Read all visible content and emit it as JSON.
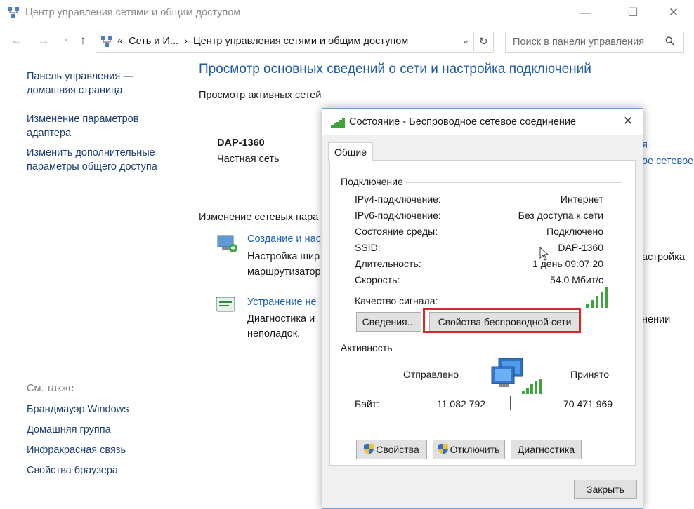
{
  "window": {
    "title": "Центр управления сетями и общим доступом",
    "minimize_symbol": "—",
    "maximize_symbol": "☐",
    "close_symbol": "✕"
  },
  "address": {
    "back_symbol": "←",
    "forward_symbol": "→",
    "dropdown_symbol": "⌄",
    "up_symbol": "↑",
    "chevrons": "«",
    "crumb_1": "Сеть и И...",
    "separator": "›",
    "crumb_2": "Центр управления сетями и общим доступом",
    "expand_symbol": "⌄",
    "refresh_symbol": "↻"
  },
  "search": {
    "placeholder": "Поиск в панели управления",
    "icon_symbol": "⚲"
  },
  "sidebar": {
    "home_line1": "Панель управления —",
    "home_line2": "домашняя страница",
    "adapter_line1": "Изменение параметров",
    "adapter_line2": "адаптера",
    "sharing_line1": "Изменить дополнительные",
    "sharing_line2": "параметры общего доступа",
    "see_also": "См. также",
    "links": [
      "Брандмауэр Windows",
      "Домашняя группа",
      "Инфракрасная связь",
      "Свойства браузера"
    ]
  },
  "main": {
    "heading": "Просмотр основных сведений о сети и настройка подключений",
    "active_networks": "Просмотр активных сетей",
    "network_name": "DAP-1360",
    "network_type": "Частная сеть",
    "right_link_1": "я",
    "right_link_2": "ое сетевое",
    "change_settings": "Изменение сетевых пара",
    "create_link": "Создание и нас",
    "create_desc_1": "Настройка шир",
    "create_desc_2": "маршрутизатор",
    "create_right": "астройка",
    "troubleshoot_link": "Устранение не",
    "troubleshoot_desc_1": "Диагностика и",
    "troubleshoot_desc_2": "неполадок.",
    "troubleshoot_right": "нении"
  },
  "dialog": {
    "title": "Состояние - Беспроводное сетевое соединение",
    "close_symbol": "✕",
    "tab": "Общие",
    "connection_group": "Подключение",
    "rows": [
      {
        "label": "IPv4-подключение:",
        "value": "Интернет"
      },
      {
        "label": "IPv6-подключение:",
        "value": "Без доступа к сети"
      },
      {
        "label": "Состояние среды:",
        "value": "Подключено"
      },
      {
        "label": "SSID:",
        "value": "DAP-1360"
      },
      {
        "label": "Длительность:",
        "value": "1 день 09:07:20"
      },
      {
        "label": "Скорость:",
        "value": "54.0 Мбит/с"
      }
    ],
    "signal_label": "Качество сигнала:",
    "signal_bars": 5,
    "details_button": "Сведения...",
    "wireless_props_button": "Свойства беспроводной сети",
    "activity_group": "Активность",
    "sent_label": "Отправлено",
    "received_label": "Принято",
    "bytes_label": "Байт:",
    "bytes_sent": "11 082 792",
    "bytes_received": "70 471 969",
    "properties_button": "Свойства",
    "disable_button": "Отключить",
    "diagnose_button": "Диагностика",
    "close_button": "Закрыть"
  },
  "colors": {
    "link": "#1a5fb4",
    "heading": "#1f5aa6",
    "highlight": "#d8262c",
    "signal": "#3fa33f"
  }
}
